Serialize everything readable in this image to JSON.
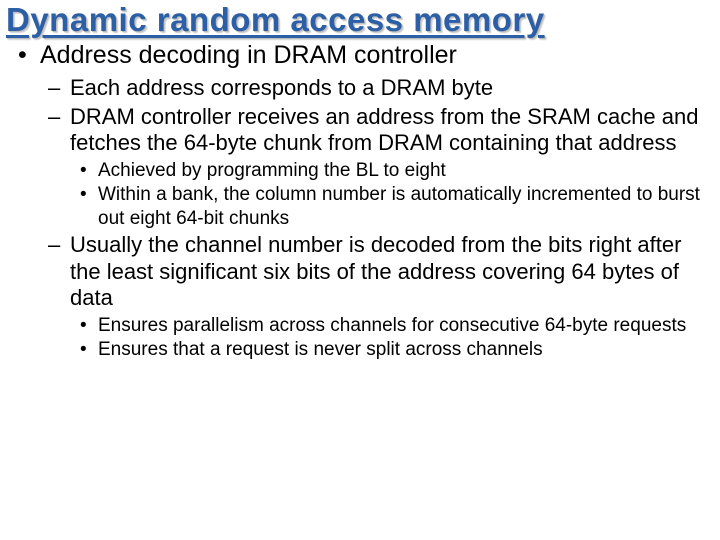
{
  "title": "Dynamic random access memory",
  "bullets": {
    "l1_0": "Address decoding in DRAM controller",
    "l2_0": "Each address corresponds to a DRAM byte",
    "l2_1": "DRAM controller receives an address from the SRAM cache and fetches the 64-byte chunk from DRAM containing that address",
    "l3_0": "Achieved by programming the BL to eight",
    "l3_1": "Within a bank, the column number is automatically incremented to burst out eight 64-bit chunks",
    "l2_2": "Usually the channel number is decoded from the bits right after the least significant six bits of the address covering 64 bytes of data",
    "l3_2": "Ensures parallelism across channels for consecutive 64-byte requests",
    "l3_3": "Ensures that a request is never split across channels"
  }
}
